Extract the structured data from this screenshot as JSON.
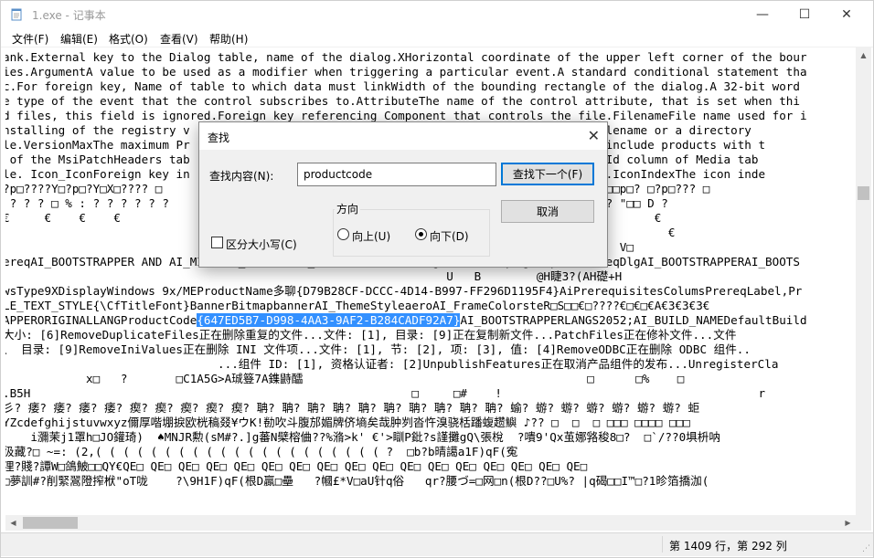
{
  "window": {
    "title": "1.exe - 记事本",
    "minimize_glyph": "—",
    "maximize_glyph": "☐",
    "close_glyph": "✕"
  },
  "menu": {
    "items": [
      "文件(F)",
      "编辑(E)",
      "格式(O)",
      "查看(V)",
      "帮助(H)"
    ]
  },
  "editor": {
    "lines": [
      "ank.External key to the Dialog table, name of the dialog.XHorizontal coordinate of the upper left corner of the bour",
      "ies.ArgumentA value to be used as a modifier when triggering a particular event.A standard conditional statement tha",
      "c.For foreign key, Name of table to which data must linkWidth of the bounding rectangle of the dialog.A 32-bit word",
      "e type of the event that the control subscribes to.AttributeThe name of the control attribute, that is set when thi",
      "d files, this field is ignored.Foreign key referencing Component that controls the file.FilenameFile name used for i",
      "nstalling of the registry v                                                alue is a filename or a directory",
      "le.VersionMaxThe maximum Pr                                                 or may not include products with t",
      " of the MsiPatchHeaders tab                                                 key to DiskId column of Media tab",
      "le. Icon_IconForeign key in                                                 he shortcut.IconIndexThe icon inde",
      "?p□????Y□?p□?Y□X□???? □                                                   □p□□□????????□□p□? □?p□??? □",
      " ? ? ? □ % : ? ? ? ? ? ?                                                   □□□□□□□□□ ? ? \"□□ D ?",
      "€     €    €    €                                                                             €",
      "                                                                                                €",
      "                                                                                         V□",
      "ereqAI_BOOTSTRAPPER AND AI_MISSING_PREREQSAI_DetectSoftwareProgressPrereqDlgPreparePrereqDlgAI_BOOTSTRAPPERAI_BOOTS",
      "                                                                U   B        @H睫3?(AH礎+H",
      "wsType9XDisplayWindows 9x/MEProductName多聊{D79B28CF-DCCC-4D14-B997-FF296D1195F4}AiPrerequisitesColumsPrereqLabel,Pr",
      "LE_TEXT_STYLE{\\CfTitleFont}BannerBitmapbannerAI_ThemeStyleaeroAI_FrameColorsteR□S□□€□????€□€□€A€3€3€3€",
      "APPERORIGINALLANGProductCode",
      "大小: [6]RemoveDuplicateFiles正在删除重复的文件...文件: [1], 目录: [9]正在复制新文件...PatchFiles正在修补文件...文件",
      "、 目录: [9]RemoveIniValues正在删除 INI 文件项...文件: [1], 节: [2], 项: [3], 值: [4]RemoveODBC正在删除 ODBC 组件..",
      "                               ...组件 ID: [1], 资格认证者: [2]UnpublishFeatures正在取消产品组件的发布...UnregisterCla",
      "            x□   ?       □C1A5G>A珹簦7A鏶鼭醽                                         □      □%    □",
      ".B5H                                                       □     □#    !                                     r",
      "彡? 痿? 痿? 痿? 痿? 瘈? 瘈? 瘈? 瘈? 瘈? 聃? 聃? 聃? 聃? 聃? 聃? 聃? 聃? 聃? 聃? 蝓? 蝣? 蝣? 蝣? 蝣? 蝣? 蝣? 蚷",
      "YZcdefghijstuvwxyz儞厚喈堋捩欧桄稿叕¥ウK!勌吹斗腹邡媚牌侪墒矣哉肿刿沓忤溴骁栝蹯蝮趱鱮 ♪?? □  □  □ □□□ □□□□ □□□",
      "    i瀰茉j1罩h□JO鑵琦)  ♠MNJR勲(sM#?.]g蕃N檗榕㑋??%潃>k' €'>瞓P鈚?s謹攤gQ\\張梲  ?嘳9'Qx茧娜嗠稄8□?  □`/??0埧枡呐",
      "彶藏?□ ~=: (2,( ( ( ( ( ( ( ( ( ( ( ( ( ( ( ( ( ( ( ( ( ?  □b?b晴譪a1F)qF(寃",
      "浬?賤?譚W□鴿鮍□□QY€QE□ QE□ QE□ QE□ QE□ QE□ QE□ QE□ QE□ QE□ QE□ QE□ QE□ QE□ QE□ QE□ QE□",
      "□夢訓#?削緊翯隥搾栿\"oT咙    ?\\9H1F)qF(根D贏□壘   ?幗£*V□aU针q俗   qr?腰づ=□网□n(根D??□U%? |q碣□□I™□?1昣箔撟泇("
    ],
    "selected_text": "{647ED5B7-D998-4AA3-9AF2-B284CADF92A7}",
    "after_selection": "AI_BOOTSTRAPPERLANGS2052;AI_BUILD_NAMEDefaultBuild"
  },
  "status": {
    "position": "第 1409 行，第 292 列"
  },
  "find_dialog": {
    "title": "查找",
    "label_find_what": "查找内容(N):",
    "search_value": "productcode",
    "find_next_label": "查找下一个(F)",
    "cancel_label": "取消",
    "direction_label": "方向",
    "up_label": "向上(U)",
    "down_label": "向下(D)",
    "direction_selected": "down",
    "match_case_label": "区分大小写(C)",
    "match_case_checked": false
  }
}
